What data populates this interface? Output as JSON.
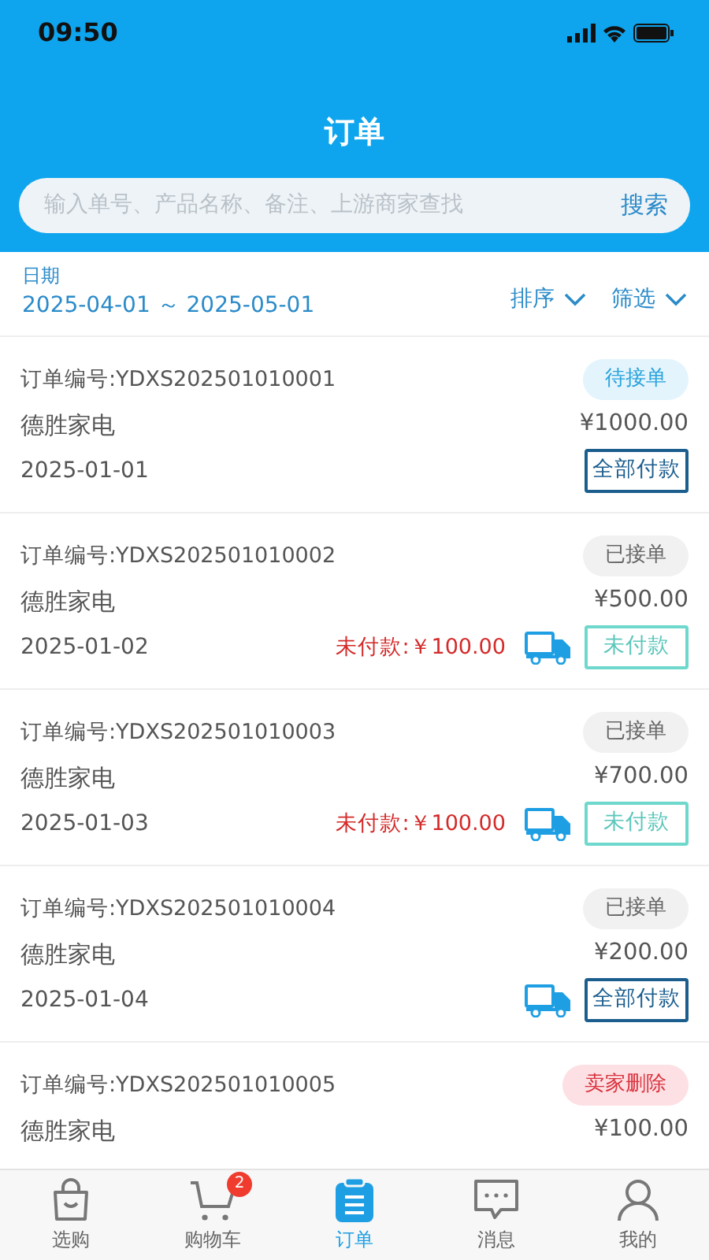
{
  "status_bar": {
    "time": "09:50"
  },
  "header": {
    "title": "订单",
    "search": {
      "placeholder": "输入单号、产品名称、备注、上游商家查找",
      "button": "搜索"
    }
  },
  "filter_bar": {
    "date_label": "日期",
    "date_range": "2025-04-01 ～ 2025-05-01",
    "sort": "排序",
    "filter": "筛选"
  },
  "orders": [
    {
      "number": "订单编号:YDXS202501010001",
      "status": "待接单",
      "kind": "pending",
      "shop": "德胜家电",
      "amount": "¥1000.00",
      "date": "2025-01-01",
      "truck": false,
      "payment": {
        "label": "全部付款",
        "kind": "full"
      }
    },
    {
      "number": "订单编号:YDXS202501010002",
      "status": "已接单",
      "kind": "accepted",
      "shop": "德胜家电",
      "amount": "¥500.00",
      "date": "2025-01-02",
      "unpaid": "未付款:￥100.00",
      "truck": true,
      "payment": {
        "label": "未付款",
        "kind": "unpaid"
      }
    },
    {
      "number": "订单编号:YDXS202501010003",
      "status": "已接单",
      "kind": "accepted",
      "shop": "德胜家电",
      "amount": "¥700.00",
      "date": "2025-01-03",
      "unpaid": "未付款:￥100.00",
      "truck": true,
      "payment": {
        "label": "未付款",
        "kind": "unpaid"
      }
    },
    {
      "number": "订单编号:YDXS202501010004",
      "status": "已接单",
      "kind": "accepted",
      "shop": "德胜家电",
      "amount": "¥200.00",
      "date": "2025-01-04",
      "truck": true,
      "payment": {
        "label": "全部付款",
        "kind": "full"
      }
    },
    {
      "number": "订单编号:YDXS202501010005",
      "status": "卖家删除",
      "kind": "deleted",
      "shop": "德胜家电",
      "amount": "¥100.00"
    }
  ],
  "tab_bar": [
    {
      "label": "选购",
      "kind": "bag",
      "selected": false
    },
    {
      "label": "购物车",
      "kind": "cart",
      "selected": false,
      "badge": "2"
    },
    {
      "label": "订单",
      "kind": "clipboard",
      "selected": true
    },
    {
      "label": "消息",
      "kind": "chat",
      "selected": false
    },
    {
      "label": "我的",
      "kind": "person",
      "selected": false
    }
  ]
}
